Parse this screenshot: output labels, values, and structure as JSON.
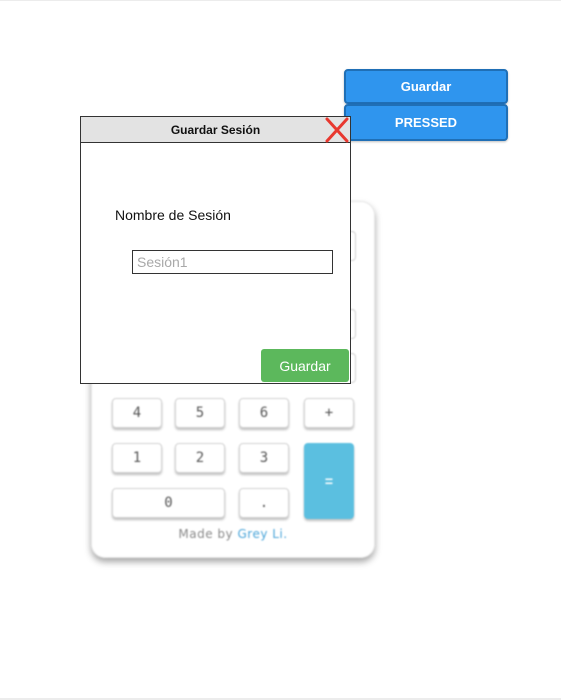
{
  "toolbar": {
    "guardar_label": "Guardar",
    "pressed_label": "PRESSED"
  },
  "calculator": {
    "keys": {
      "four": "4",
      "five": "5",
      "six": "6",
      "plus": "+",
      "one": "1",
      "two": "2",
      "three": "3",
      "equals": "=",
      "zero": "0",
      "dot": "."
    },
    "credit_prefix": "Made by ",
    "credit_name": "Grey Li."
  },
  "dialog": {
    "title": "Guardar Sesión",
    "field_label": "Nombre de Sesión",
    "input_value": "",
    "input_placeholder": "Sesión1",
    "save_label": "Guardar"
  },
  "colors": {
    "primary_blue": "#2f95ee",
    "save_green": "#5cb85c",
    "close_red": "#e8382f",
    "equals_blue": "#5bbfe0"
  }
}
